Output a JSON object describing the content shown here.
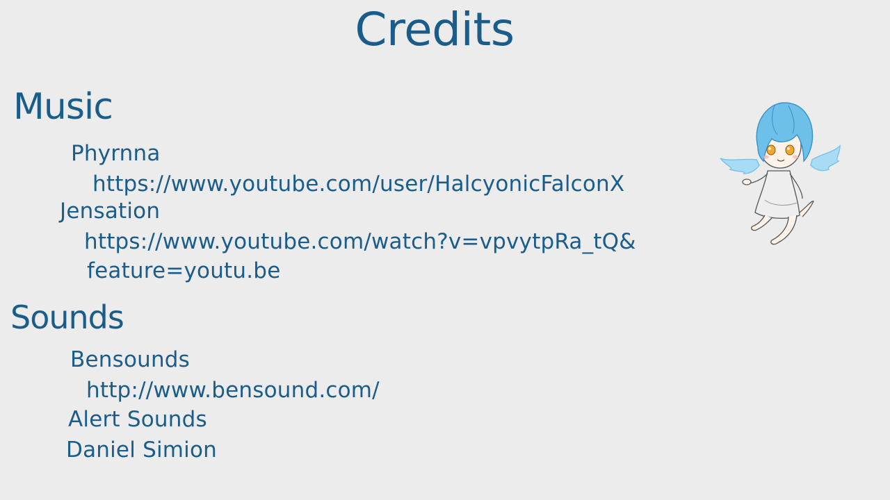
{
  "title": "Credits",
  "music": {
    "heading": "Music",
    "entries": [
      {
        "name": "Phyrnna",
        "link": "https://www.youtube.com/user/HalcyonicFalconX"
      },
      {
        "name": "Jensation",
        "link_line1": "https://www.youtube.com/watch?v=vpvytpRa_tQ&",
        "link_line2": "feature=youtu.be"
      }
    ]
  },
  "sounds": {
    "heading": "Sounds",
    "entries": [
      {
        "name": "Bensounds",
        "link": "http://www.bensound.com/"
      },
      {
        "name": "Alert Sounds"
      },
      {
        "name": "Daniel Simion"
      }
    ]
  },
  "mascot": {
    "icon": "winged-chibi-girl-icon"
  },
  "colors": {
    "text": "#1a5c8a",
    "background": "#ececec",
    "hair": "#6cc0ea",
    "wings": "#a8dcf5",
    "eyes": "#f0a830"
  }
}
